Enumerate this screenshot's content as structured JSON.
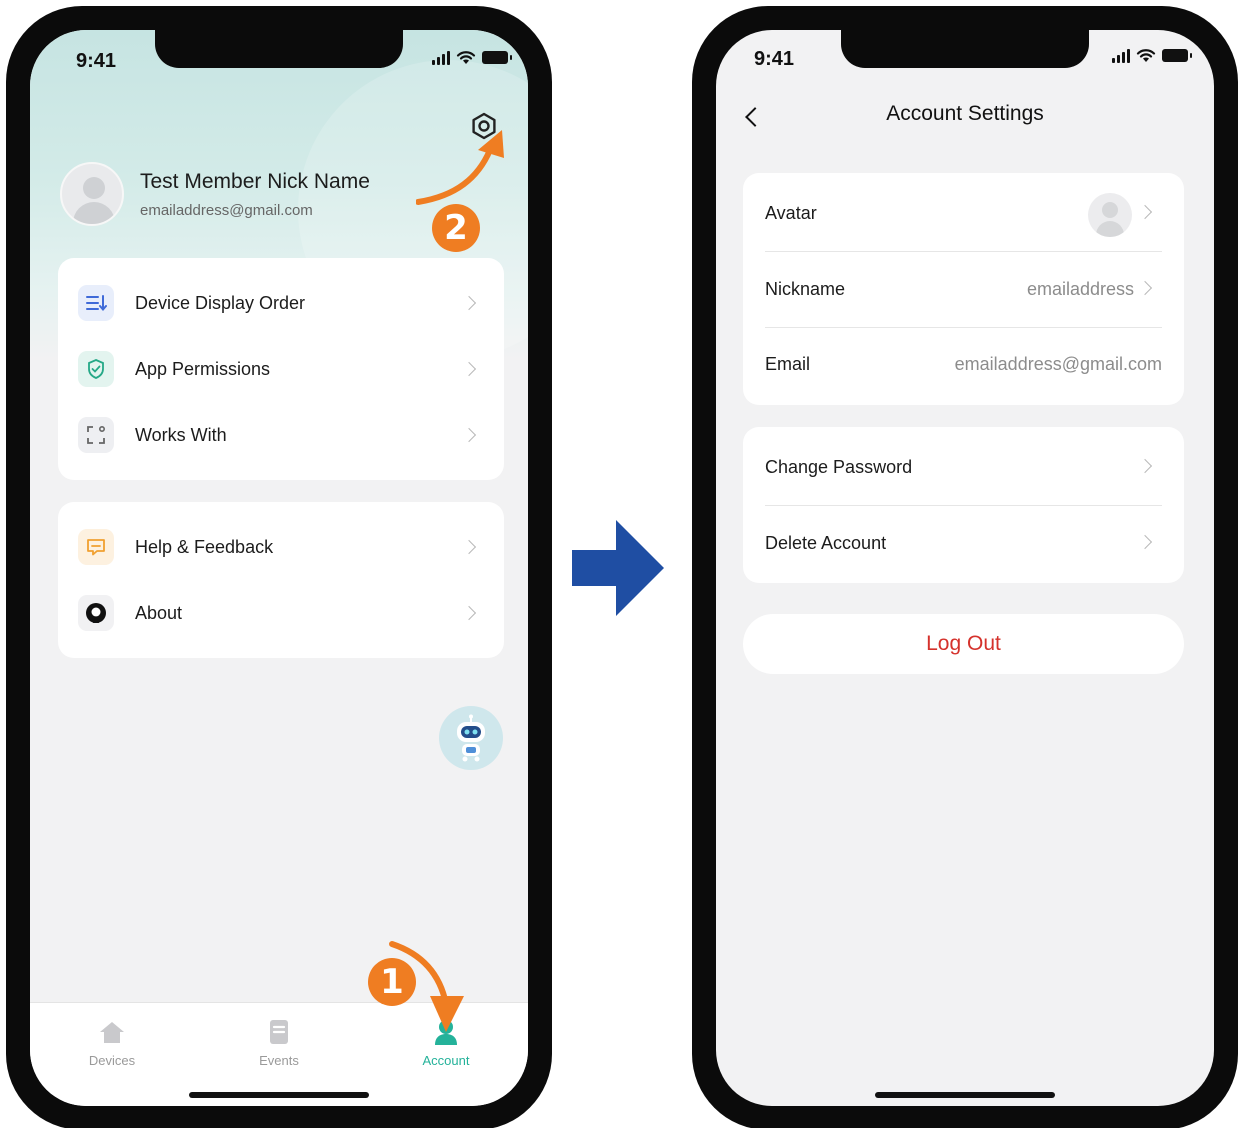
{
  "status_bar": {
    "time": "9:41"
  },
  "account_screen": {
    "profile": {
      "name": "Test Member Nick Name",
      "email": "emailaddress@gmail.com"
    },
    "menu_group_1": [
      {
        "label": "Device Display Order",
        "icon": "sort-list-icon"
      },
      {
        "label": "App Permissions",
        "icon": "shield-check-icon"
      },
      {
        "label": "Works With",
        "icon": "scan-frame-icon"
      }
    ],
    "menu_group_2": [
      {
        "label": "Help & Feedback",
        "icon": "message-icon"
      },
      {
        "label": "About",
        "icon": "app-logo-icon"
      }
    ],
    "tabbar": [
      {
        "label": "Devices",
        "icon": "home-icon"
      },
      {
        "label": "Events",
        "icon": "events-icon"
      },
      {
        "label": "Account",
        "icon": "account-icon",
        "active": true
      }
    ],
    "annotations": {
      "step_1": "1",
      "step_2": "2"
    },
    "colors": {
      "active_tab": "#24b29a",
      "annotation": "#ef7d22"
    }
  },
  "settings_screen": {
    "title": "Account Settings",
    "profile_rows": [
      {
        "label": "Avatar"
      },
      {
        "label": "Nickname",
        "value": "emailaddress"
      },
      {
        "label": "Email",
        "value": "emailaddress@gmail.com"
      }
    ],
    "security_rows": [
      {
        "label": "Change Password"
      },
      {
        "label": "Delete Account"
      }
    ],
    "logout_label": "Log Out",
    "colors": {
      "logout": "#d5322c"
    }
  },
  "transition_arrow_color": "#1f4ea3"
}
